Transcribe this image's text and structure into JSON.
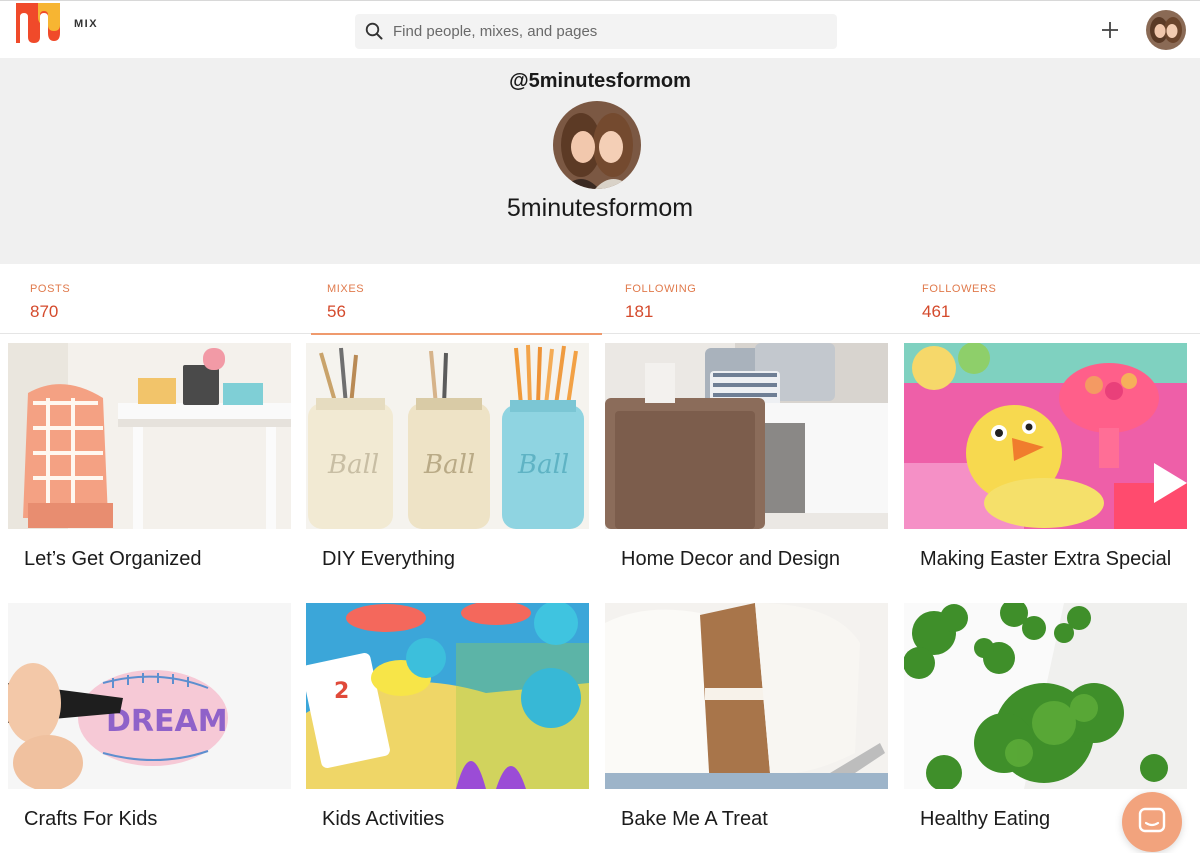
{
  "app": {
    "brand": "MIX"
  },
  "search": {
    "placeholder": "Find people, mixes, and pages"
  },
  "profile": {
    "handle": "@5minutesformom",
    "display_name": "5minutesformom"
  },
  "stats": [
    {
      "label": "POSTS",
      "count": "870"
    },
    {
      "label": "MIXES",
      "count": "56",
      "active": true
    },
    {
      "label": "FOLLOWING",
      "count": "181"
    },
    {
      "label": "FOLLOWERS",
      "count": "461"
    }
  ],
  "mixes": [
    {
      "title": "Let’s Get Organized"
    },
    {
      "title": "DIY Everything"
    },
    {
      "title": "Home Decor and Design"
    },
    {
      "title": "Making Easter Extra Special"
    },
    {
      "title": "Crafts For Kids"
    },
    {
      "title": "Kids Activities"
    },
    {
      "title": "Bake Me A Treat"
    },
    {
      "title": "Healthy Eating"
    }
  ],
  "colors": {
    "accent": "#e07a4c",
    "count": "#d44a2c",
    "tab_underline": "#ef9a6d",
    "header_bg": "#f0f0f0"
  },
  "icons": {
    "search": "search-icon",
    "add": "plus-icon",
    "chat": "chat-icon"
  }
}
